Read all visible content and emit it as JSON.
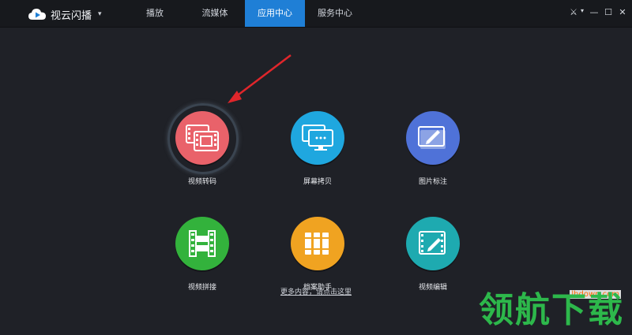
{
  "app": {
    "name": "视云闪播",
    "menu_caret": "▾"
  },
  "tabs": [
    {
      "label": "播放",
      "active": false
    },
    {
      "label": "流媒体",
      "active": false
    },
    {
      "label": "应用中心",
      "active": true
    },
    {
      "label": "服务中心",
      "active": false
    }
  ],
  "window_controls": {
    "settings": "⚔",
    "settings_caret": "▾",
    "minimize": "—",
    "maximize": "☐",
    "close": "✕"
  },
  "apps": [
    {
      "label": "视频转码",
      "icon": "video-transcode-icon",
      "color": "#e9626a",
      "highlighted": true
    },
    {
      "label": "屏幕拷贝",
      "icon": "screen-copy-icon",
      "color": "#1fa7df",
      "highlighted": false
    },
    {
      "label": "图片标注",
      "icon": "image-annotate-icon",
      "color": "#4f72d8",
      "highlighted": false
    },
    {
      "label": "视频拼接",
      "icon": "video-splice-icon",
      "color": "#33b23c",
      "highlighted": false
    },
    {
      "label": "档案助手",
      "icon": "archive-assistant-icon",
      "color": "#f0a321",
      "highlighted": false
    },
    {
      "label": "视频编辑",
      "icon": "video-edit-icon",
      "color": "#1eaab0",
      "highlighted": false
    }
  ],
  "footer": {
    "link_text": "更多内容，请点击这里"
  },
  "annotation": {
    "arrow_color": "#e0262b"
  },
  "watermark": {
    "text": "领航下载",
    "url": "lhdown.com"
  }
}
